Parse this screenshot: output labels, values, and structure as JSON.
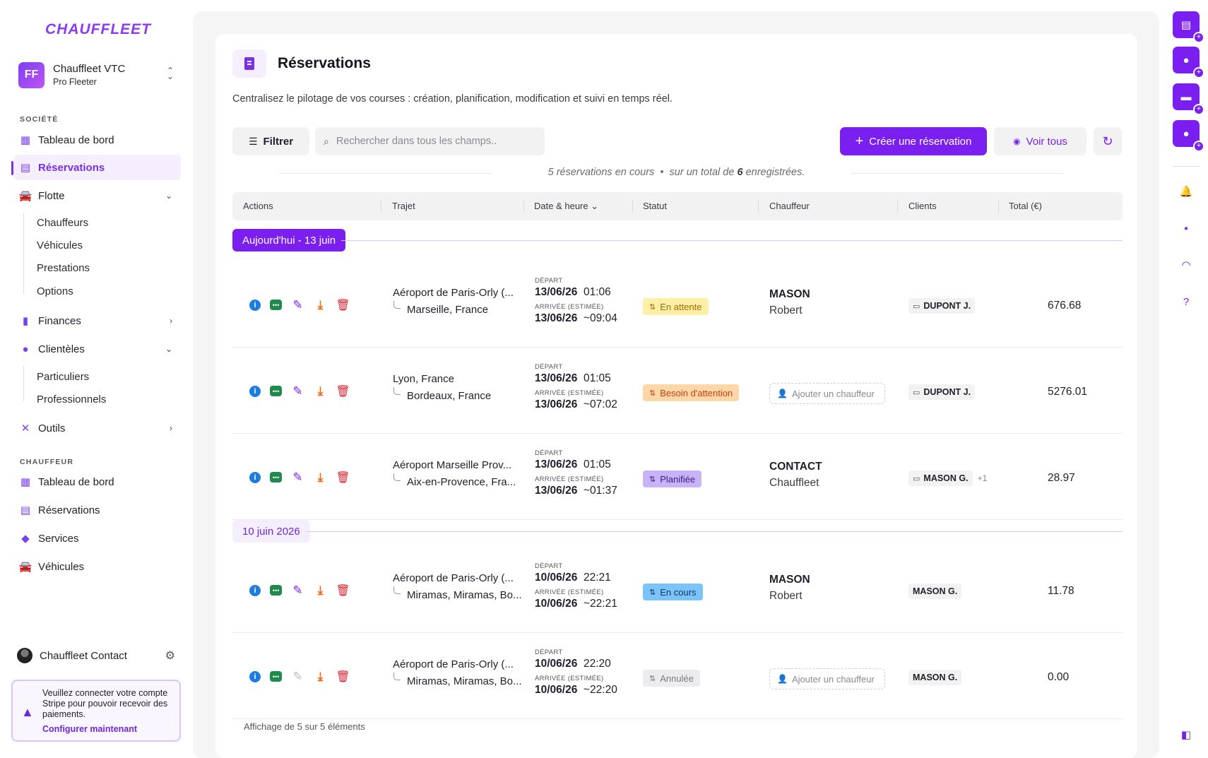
{
  "app": {
    "logo": "CHAUFFLEET"
  },
  "company": {
    "initials": "FF",
    "name": "Chauffleet VTC",
    "plan": "Pro Fleeter"
  },
  "sidebar": {
    "section_company": "SOCIÉTÉ",
    "section_driver": "CHAUFFEUR",
    "company_items": [
      {
        "label": "Tableau de bord"
      },
      {
        "label": "Réservations"
      },
      {
        "label": "Flotte"
      },
      {
        "label": "Finances"
      },
      {
        "label": "Clientèles"
      },
      {
        "label": "Outils"
      }
    ],
    "fleet_sub": [
      "Chauffeurs",
      "Véhicules",
      "Prestations",
      "Options"
    ],
    "clients_sub": [
      "Particuliers",
      "Professionnels"
    ],
    "driver_items": [
      {
        "label": "Tableau de bord"
      },
      {
        "label": "Réservations"
      },
      {
        "label": "Services"
      },
      {
        "label": "Véhicules"
      }
    ],
    "user": {
      "name": "Chauffleet Contact"
    },
    "stripe": {
      "text": "Veuillez connecter votre compte Stripe pour pouvoir recevoir des paiements.",
      "link": "Configurer maintenant"
    }
  },
  "page": {
    "title": "Réservations",
    "description": "Centralisez le pilotage de vos courses : création, planification, modification et suivi en temps réel."
  },
  "toolbar": {
    "filter_label": "Filtrer",
    "search_placeholder": "Rechercher dans tous les champs..",
    "create_label": "Créer une réservation",
    "viewall_label": "Voir tous"
  },
  "summary": {
    "active_count": "5",
    "active_text": "réservations en cours",
    "separator": "•",
    "total_prefix": "sur un total de",
    "total_count": "6",
    "total_suffix": "enregistrées."
  },
  "table": {
    "headers": [
      "Actions",
      "Trajet",
      "Date & heure",
      "Statut",
      "Chauffeur",
      "Clients",
      "Total (€)"
    ],
    "depart_label": "DÉPART",
    "arrival_label": "ARRIVÉE (ESTIMÉE)",
    "add_driver_label": "Ajouter un chauffeur",
    "groups": [
      {
        "label": "Aujourd'hui - 13 juin"
      },
      {
        "label": "10 juin 2026"
      }
    ],
    "rows": [
      {
        "from": "Aéroport de Paris-Orly (...",
        "to": "Marseille, France",
        "dep_date": "13/06/26",
        "dep_time": "01:06",
        "arr_date": "13/06/26",
        "arr_time": "~09:04",
        "status": "En attente",
        "status_bg": "#fdf0a6",
        "status_fg": "#a26b00",
        "driver_last": "MASON",
        "driver_first": "Robert",
        "client": "DUPONT J.",
        "client_extra": "",
        "total": "676.68"
      },
      {
        "from": "Lyon, France",
        "to": "Bordeaux, France",
        "dep_date": "13/06/26",
        "dep_time": "01:05",
        "arr_date": "13/06/26",
        "arr_time": "~07:02",
        "status": "Besoin d'attention",
        "status_bg": "#fdd7a8",
        "status_fg": "#c2410c",
        "driver_last": "",
        "driver_first": "",
        "client": "DUPONT J.",
        "client_extra": "",
        "total": "5276.01"
      },
      {
        "from": "Aéroport Marseille Prov...",
        "to": "Aix-en-Provence, Fra...",
        "dep_date": "13/06/26",
        "dep_time": "01:05",
        "arr_date": "13/06/26",
        "arr_time": "~01:37",
        "status": "Planifiée",
        "status_bg": "#c9b3f7",
        "status_fg": "#3b1a8a",
        "driver_last": "CONTACT",
        "driver_first": "Chauffleet",
        "client": "MASON G.",
        "client_extra": "+1",
        "total": "28.97"
      },
      {
        "from": "Aéroport de Paris-Orly (...",
        "to": "Miramas, Miramas, Bo...",
        "dep_date": "10/06/26",
        "dep_time": "22:21",
        "arr_date": "10/06/26",
        "arr_time": "~22:21",
        "status": "En cours",
        "status_bg": "#7cc3f7",
        "status_fg": "#0b3a66",
        "driver_last": "MASON",
        "driver_first": "Robert",
        "client": "MASON G.",
        "client_extra": "",
        "total": "11.78"
      },
      {
        "from": "Aéroport de Paris-Orly (...",
        "to": "Miramas, Miramas, Bo...",
        "dep_date": "10/06/26",
        "dep_time": "22:20",
        "arr_date": "10/06/26",
        "arr_time": "~22:20",
        "status": "Annulée",
        "status_bg": "#ececee",
        "status_fg": "#7a7a82",
        "driver_last": "",
        "driver_first": "",
        "client": "MASON G.",
        "client_extra": "",
        "total": "0.00"
      }
    ],
    "footer": "Affichage de 5 sur 5 éléments"
  },
  "colors": {
    "accent": "#7b1ff0",
    "accent_soft": "#f4eefe"
  }
}
